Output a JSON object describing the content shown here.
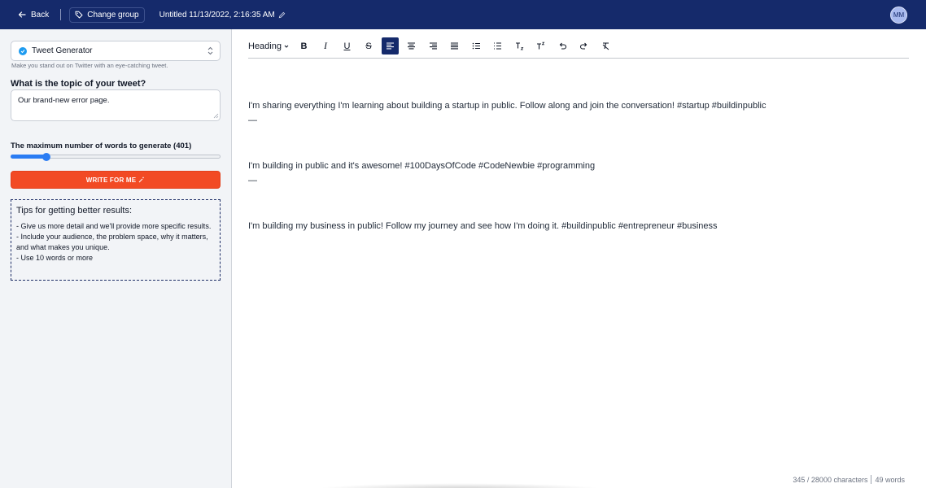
{
  "topbar": {
    "back_label": "Back",
    "change_group_label": "Change group",
    "document_title": "Untitled 11/13/2022, 2:16:35 AM",
    "avatar_initials": "MM",
    "bg_color": "#152a6b"
  },
  "sidebar": {
    "generator": {
      "selected": "Tweet Generator",
      "help": "Make you stand out on Twitter with an eye-catching tweet."
    },
    "topic": {
      "label": "What is the topic of your tweet?",
      "value": "Our brand-new error page."
    },
    "max_words": {
      "label": "The maximum number of words to generate (401)",
      "value_fraction": 0.17
    },
    "write_button": {
      "label": "WRITE FOR ME",
      "color": "#f24a24"
    },
    "tips": {
      "title": "Tips for getting better results:",
      "items": [
        "- Give us more detail and we'll provide more specific results.",
        "- Include your audience, the problem space, why it matters, and what makes you unique.",
        "- Use 10 words or more"
      ]
    }
  },
  "editor": {
    "toolbar": {
      "heading_label": "Heading",
      "buttons": [
        {
          "name": "bold",
          "icon": "bold-icon"
        },
        {
          "name": "italic",
          "icon": "italic-icon"
        },
        {
          "name": "underline",
          "icon": "underline-icon"
        },
        {
          "name": "strikethrough",
          "icon": "strikethrough-icon"
        },
        {
          "name": "align-left",
          "icon": "align-left-icon",
          "active": true
        },
        {
          "name": "align-center",
          "icon": "align-center-icon"
        },
        {
          "name": "align-right",
          "icon": "align-right-icon"
        },
        {
          "name": "align-justify",
          "icon": "align-justify-icon"
        },
        {
          "name": "bullet-list",
          "icon": "bullet-list-icon"
        },
        {
          "name": "numbered-list",
          "icon": "numbered-list-icon"
        },
        {
          "name": "subscript",
          "icon": "subscript-icon"
        },
        {
          "name": "superscript",
          "icon": "superscript-icon"
        },
        {
          "name": "undo",
          "icon": "undo-icon"
        },
        {
          "name": "redo",
          "icon": "redo-icon"
        },
        {
          "name": "clear-format",
          "icon": "clear-format-icon"
        }
      ]
    },
    "paragraphs": [
      "I'm sharing everything I'm learning about building a startup in public. Follow along and join the conversation! #startup #buildinpublic",
      "—",
      "I'm building in public and it's awesome! #100DaysOfCode #CodeNewbie #programming",
      "—",
      "I'm building my business in public! Follow my journey and see how I'm doing it. #buildinpublic #entrepreneur #business"
    ],
    "stats": {
      "characters": "345 / 28000 characters",
      "words": "49 words"
    }
  }
}
